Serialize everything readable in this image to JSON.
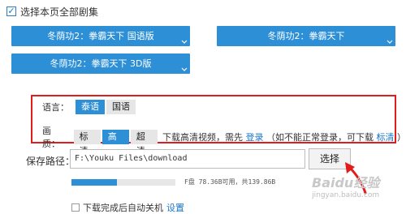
{
  "select_all": {
    "checked": true,
    "label": "选择本页全部剧集"
  },
  "episodes": [
    {
      "label": "冬荫功2：拳霸天下  国语版"
    },
    {
      "label": "冬荫功2：拳霸天下"
    },
    {
      "label": "冬荫功2：拳霸天下    3D版"
    }
  ],
  "language": {
    "label": "语言：",
    "options": [
      "泰语",
      "国语"
    ],
    "selected": "泰语"
  },
  "quality": {
    "label": "画质：",
    "options": [
      "标清",
      "高清",
      "超清"
    ],
    "selected": "高清",
    "hint_prefix": "下载高清视频，需先",
    "login_link": "登录",
    "hint_middle": "（如不能正常登录，可下载",
    "standard_link": "标清",
    "hint_suffix": "）"
  },
  "save_path": {
    "label": "保存路径：",
    "value": "F:\\Youku Files\\download",
    "choose_label": "选择"
  },
  "disk": {
    "info": "F盘 78.36B可用，共139.86B",
    "used_fraction": 0.44
  },
  "footer_partial": {
    "text": "下载完成后自动关机",
    "link": "设置"
  },
  "watermark": {
    "brand": "Baidu经验",
    "url": "jingyan.baidu.com"
  },
  "colors": {
    "accent": "#2d8fd6",
    "highlight_border": "#e21b1b",
    "arrow": "#e21b1b"
  }
}
